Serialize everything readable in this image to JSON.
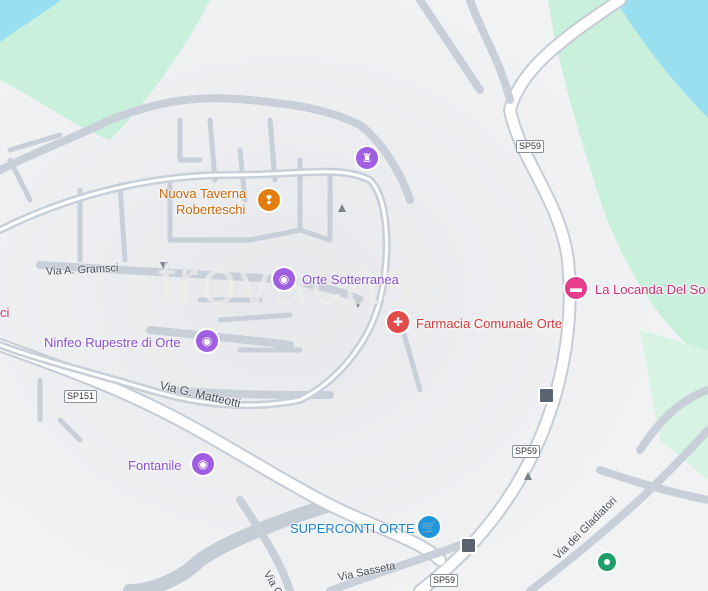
{
  "colors": {
    "water": "#99dff0",
    "park": "#c9f0dc",
    "road": "#c8cfd9",
    "road_fill": "#ffffff",
    "food": "#e37d0f",
    "attraction": "#a05ee3",
    "health": "#e34a4a",
    "lodging": "#e53c8c",
    "shopping": "#1e96e0",
    "transit": "#5b6270",
    "green_place": "#1f9e6a"
  },
  "pois": {
    "tower_icon": "castle-icon",
    "taverna": {
      "name_line1": "Nuova Taverna",
      "name_line2": "Roberteschi",
      "icon": "fork-knife-icon"
    },
    "sotterranea": {
      "name": "Orte Sotterranea",
      "icon": "camera-icon"
    },
    "farmacia": {
      "name": "Farmacia Comunale Orte",
      "icon": "pharmacy-icon"
    },
    "locanda": {
      "name": "La Locanda Del So",
      "icon": "bed-icon"
    },
    "ninfeo": {
      "name": "Ninfeo Rupestre di Orte",
      "icon": "camera-icon"
    },
    "fontanile": {
      "name": "Fontanile",
      "icon": "camera-icon"
    },
    "superconti": {
      "name": "SUPERCONTI ORTE",
      "icon": "cart-icon"
    },
    "partial_left": {
      "name": "ci"
    },
    "green_place": {
      "icon": "place-dot-icon"
    }
  },
  "streets": {
    "gramsci": "Via A. Gramsci",
    "matteotti": "Via G. Matteotti",
    "gladiatori": "Via dei Gladiatori",
    "sasseta": "Via Sasseta",
    "partial_c": "Via C"
  },
  "route_shields": {
    "sp59_top": "SP59",
    "sp59_mid": "SP59",
    "sp59_bottom": "SP59",
    "sp151": "SP151"
  },
  "watermark": {
    "text": "trovacasa"
  }
}
